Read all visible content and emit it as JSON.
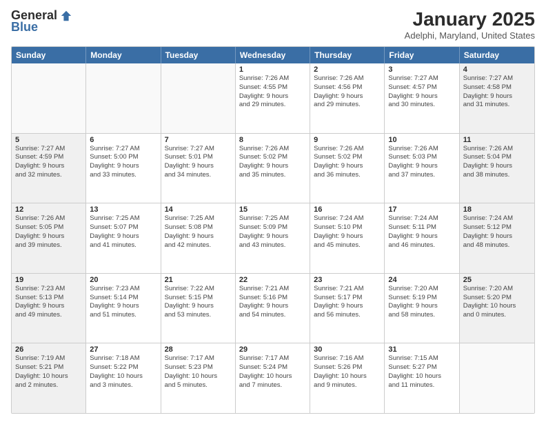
{
  "logo": {
    "general": "General",
    "blue": "Blue"
  },
  "header": {
    "month": "January 2025",
    "location": "Adelphi, Maryland, United States"
  },
  "days": [
    "Sunday",
    "Monday",
    "Tuesday",
    "Wednesday",
    "Thursday",
    "Friday",
    "Saturday"
  ],
  "rows": [
    [
      {
        "day": "",
        "info": "",
        "empty": true
      },
      {
        "day": "",
        "info": "",
        "empty": true
      },
      {
        "day": "",
        "info": "",
        "empty": true
      },
      {
        "day": "1",
        "info": "Sunrise: 7:26 AM\nSunset: 4:55 PM\nDaylight: 9 hours\nand 29 minutes.",
        "shaded": false
      },
      {
        "day": "2",
        "info": "Sunrise: 7:26 AM\nSunset: 4:56 PM\nDaylight: 9 hours\nand 29 minutes.",
        "shaded": false
      },
      {
        "day": "3",
        "info": "Sunrise: 7:27 AM\nSunset: 4:57 PM\nDaylight: 9 hours\nand 30 minutes.",
        "shaded": false
      },
      {
        "day": "4",
        "info": "Sunrise: 7:27 AM\nSunset: 4:58 PM\nDaylight: 9 hours\nand 31 minutes.",
        "shaded": true
      }
    ],
    [
      {
        "day": "5",
        "info": "Sunrise: 7:27 AM\nSunset: 4:59 PM\nDaylight: 9 hours\nand 32 minutes.",
        "shaded": true
      },
      {
        "day": "6",
        "info": "Sunrise: 7:27 AM\nSunset: 5:00 PM\nDaylight: 9 hours\nand 33 minutes.",
        "shaded": false
      },
      {
        "day": "7",
        "info": "Sunrise: 7:27 AM\nSunset: 5:01 PM\nDaylight: 9 hours\nand 34 minutes.",
        "shaded": false
      },
      {
        "day": "8",
        "info": "Sunrise: 7:26 AM\nSunset: 5:02 PM\nDaylight: 9 hours\nand 35 minutes.",
        "shaded": false
      },
      {
        "day": "9",
        "info": "Sunrise: 7:26 AM\nSunset: 5:02 PM\nDaylight: 9 hours\nand 36 minutes.",
        "shaded": false
      },
      {
        "day": "10",
        "info": "Sunrise: 7:26 AM\nSunset: 5:03 PM\nDaylight: 9 hours\nand 37 minutes.",
        "shaded": false
      },
      {
        "day": "11",
        "info": "Sunrise: 7:26 AM\nSunset: 5:04 PM\nDaylight: 9 hours\nand 38 minutes.",
        "shaded": true
      }
    ],
    [
      {
        "day": "12",
        "info": "Sunrise: 7:26 AM\nSunset: 5:05 PM\nDaylight: 9 hours\nand 39 minutes.",
        "shaded": true
      },
      {
        "day": "13",
        "info": "Sunrise: 7:25 AM\nSunset: 5:07 PM\nDaylight: 9 hours\nand 41 minutes.",
        "shaded": false
      },
      {
        "day": "14",
        "info": "Sunrise: 7:25 AM\nSunset: 5:08 PM\nDaylight: 9 hours\nand 42 minutes.",
        "shaded": false
      },
      {
        "day": "15",
        "info": "Sunrise: 7:25 AM\nSunset: 5:09 PM\nDaylight: 9 hours\nand 43 minutes.",
        "shaded": false
      },
      {
        "day": "16",
        "info": "Sunrise: 7:24 AM\nSunset: 5:10 PM\nDaylight: 9 hours\nand 45 minutes.",
        "shaded": false
      },
      {
        "day": "17",
        "info": "Sunrise: 7:24 AM\nSunset: 5:11 PM\nDaylight: 9 hours\nand 46 minutes.",
        "shaded": false
      },
      {
        "day": "18",
        "info": "Sunrise: 7:24 AM\nSunset: 5:12 PM\nDaylight: 9 hours\nand 48 minutes.",
        "shaded": true
      }
    ],
    [
      {
        "day": "19",
        "info": "Sunrise: 7:23 AM\nSunset: 5:13 PM\nDaylight: 9 hours\nand 49 minutes.",
        "shaded": true
      },
      {
        "day": "20",
        "info": "Sunrise: 7:23 AM\nSunset: 5:14 PM\nDaylight: 9 hours\nand 51 minutes.",
        "shaded": false
      },
      {
        "day": "21",
        "info": "Sunrise: 7:22 AM\nSunset: 5:15 PM\nDaylight: 9 hours\nand 53 minutes.",
        "shaded": false
      },
      {
        "day": "22",
        "info": "Sunrise: 7:21 AM\nSunset: 5:16 PM\nDaylight: 9 hours\nand 54 minutes.",
        "shaded": false
      },
      {
        "day": "23",
        "info": "Sunrise: 7:21 AM\nSunset: 5:17 PM\nDaylight: 9 hours\nand 56 minutes.",
        "shaded": false
      },
      {
        "day": "24",
        "info": "Sunrise: 7:20 AM\nSunset: 5:19 PM\nDaylight: 9 hours\nand 58 minutes.",
        "shaded": false
      },
      {
        "day": "25",
        "info": "Sunrise: 7:20 AM\nSunset: 5:20 PM\nDaylight: 10 hours\nand 0 minutes.",
        "shaded": true
      }
    ],
    [
      {
        "day": "26",
        "info": "Sunrise: 7:19 AM\nSunset: 5:21 PM\nDaylight: 10 hours\nand 2 minutes.",
        "shaded": true
      },
      {
        "day": "27",
        "info": "Sunrise: 7:18 AM\nSunset: 5:22 PM\nDaylight: 10 hours\nand 3 minutes.",
        "shaded": false
      },
      {
        "day": "28",
        "info": "Sunrise: 7:17 AM\nSunset: 5:23 PM\nDaylight: 10 hours\nand 5 minutes.",
        "shaded": false
      },
      {
        "day": "29",
        "info": "Sunrise: 7:17 AM\nSunset: 5:24 PM\nDaylight: 10 hours\nand 7 minutes.",
        "shaded": false
      },
      {
        "day": "30",
        "info": "Sunrise: 7:16 AM\nSunset: 5:26 PM\nDaylight: 10 hours\nand 9 minutes.",
        "shaded": false
      },
      {
        "day": "31",
        "info": "Sunrise: 7:15 AM\nSunset: 5:27 PM\nDaylight: 10 hours\nand 11 minutes.",
        "shaded": false
      },
      {
        "day": "",
        "info": "",
        "empty": true
      }
    ]
  ]
}
